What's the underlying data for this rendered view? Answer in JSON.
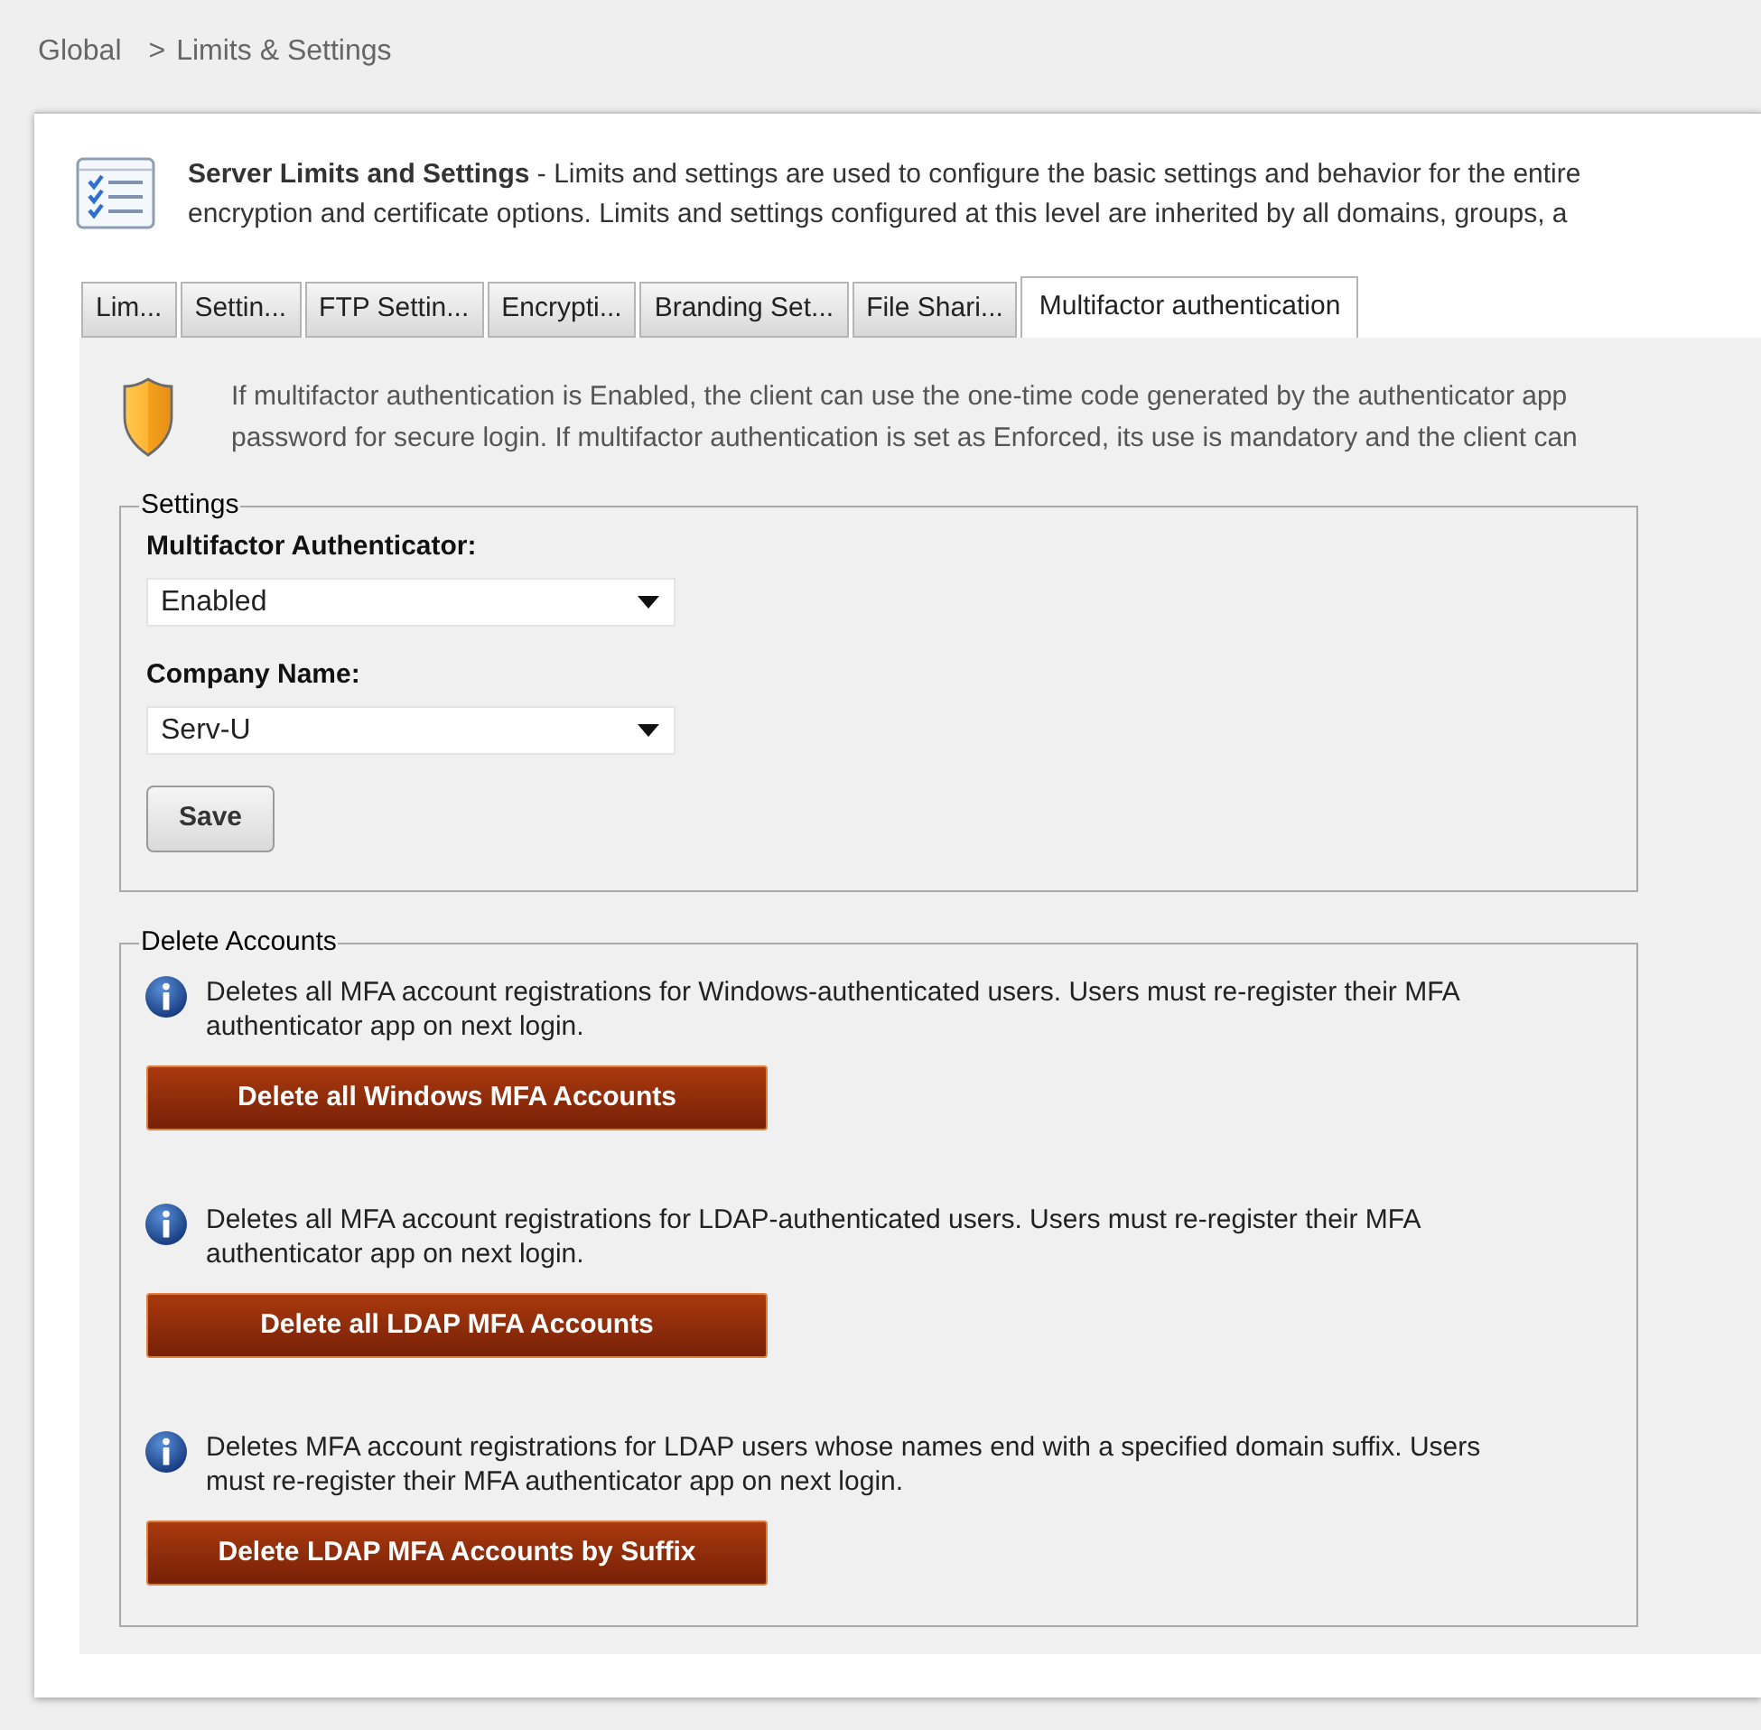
{
  "breadcrumb": {
    "items": [
      "Global",
      "Limits & Settings"
    ],
    "separator": ">"
  },
  "header": {
    "lines": [
      "**Server Limits and Settings** - Limits and settings are used to configure the basic settings and behavior for the entire",
      "encryption and certificate options. Limits and settings configured at this level are inherited by all domains, groups, a"
    ]
  },
  "tabs": [
    {
      "label": "Lim...",
      "selected": false
    },
    {
      "label": "Settin...",
      "selected": false
    },
    {
      "label": "FTP Settin...",
      "selected": false
    },
    {
      "label": "Encrypti...",
      "selected": false
    },
    {
      "label": "Branding Set...",
      "selected": false
    },
    {
      "label": "File Shari...",
      "selected": false
    },
    {
      "label": "Multifactor authentication",
      "selected": true
    }
  ],
  "mfa_panel": {
    "notice_lines": [
      "If multifactor authentication is Enabled, the client can use the one-time code generated by the authenticator app",
      "password for secure login. If multifactor authentication is set as Enforced, its use is mandatory and the client can"
    ],
    "settings": {
      "legend": "Settings",
      "fields": [
        {
          "label": "Multifactor Authenticator:",
          "value": "Enabled"
        },
        {
          "label": "Company Name:",
          "value": "Serv-U"
        }
      ],
      "save_button": "Save"
    },
    "delete_accounts": {
      "legend": "Delete Accounts",
      "actions": [
        {
          "description": "Deletes all MFA account registrations for Windows-authenticated users. Users must re-register their MFA authenticator app on next login.",
          "button": "Delete all Windows MFA Accounts"
        },
        {
          "description": "Deletes all MFA account registrations for LDAP-authenticated users. Users must re-register their MFA authenticator app on next login.",
          "button": "Delete all LDAP MFA Accounts"
        },
        {
          "description": "Deletes MFA account registrations for LDAP users whose names end with a specified domain suffix. Users must re-register their MFA authenticator app on next login.",
          "button": "Delete LDAP MFA Accounts by Suffix"
        }
      ]
    }
  }
}
